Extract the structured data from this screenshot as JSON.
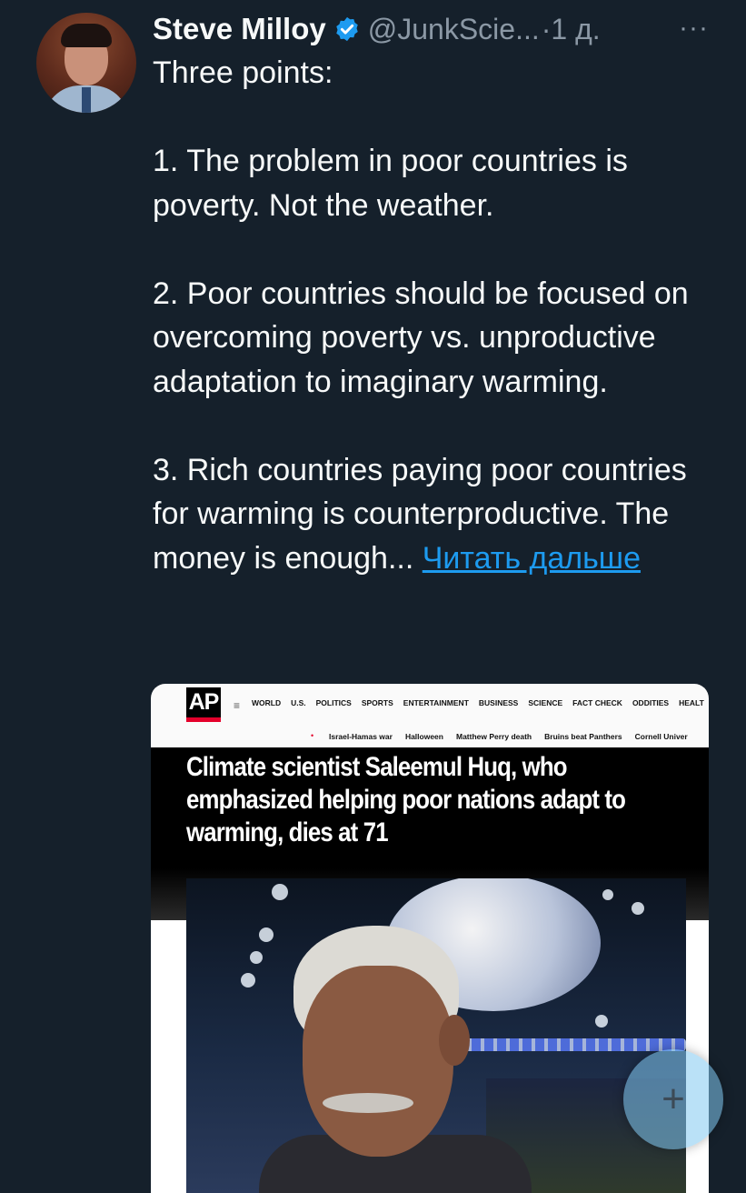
{
  "tweet": {
    "author_name": "Steve Milloy",
    "handle": "@JunkScie...",
    "time": "·1 д.",
    "more": "···",
    "text": "Three points:\n\n1. The problem in poor countries is poverty. Not the weather.\n\n2. Poor countries should be focused on overcoming poverty vs. unproductive adaptation to imaginary warming.\n\n3. Rich countries paying poor countries for warming is counterproductive. The money is enough... ",
    "read_more": "Читать дальше"
  },
  "card": {
    "logo": "AP",
    "menu_icon": "≡",
    "nav": [
      "WORLD",
      "U.S.",
      "POLITICS",
      "SPORTS",
      "ENTERTAINMENT",
      "BUSINESS",
      "SCIENCE",
      "FACT CHECK",
      "ODDITIES",
      "HEALT"
    ],
    "trending": [
      "Israel-Hamas war",
      "Halloween",
      "Matthew Perry death",
      "Bruins beat Panthers",
      "Cornell Univer"
    ],
    "headline": "Climate scientist Saleemul Huq, who emphasized helping poor nations adapt to warming, dies at 71"
  },
  "fab": {
    "icon": "plus-icon",
    "symbol": "+"
  },
  "colors": {
    "background": "#15202b",
    "link": "#1d9bf0",
    "verified": "#1d9bf0",
    "ap_red": "#e4002b"
  }
}
